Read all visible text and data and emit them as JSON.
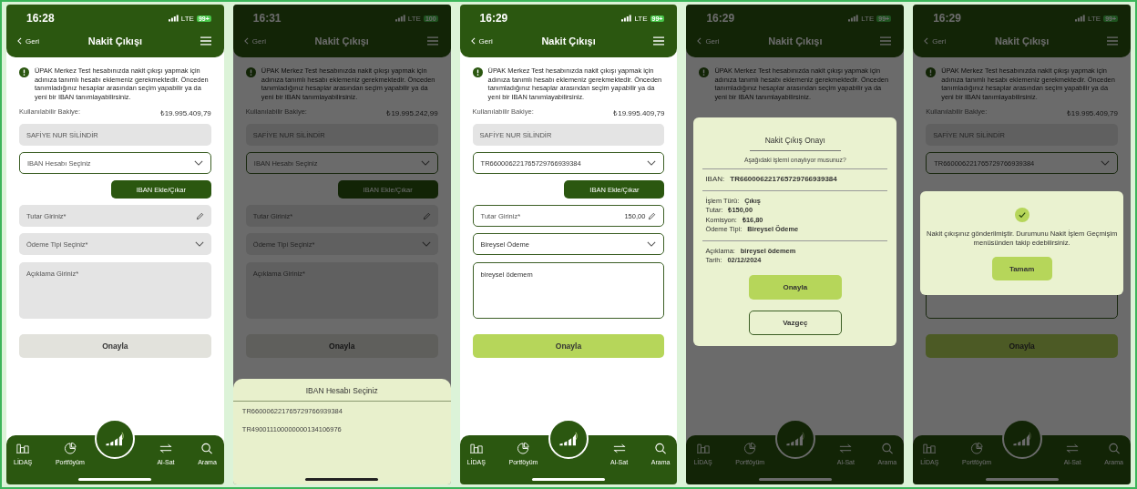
{
  "phones": [
    {
      "status": {
        "time": "16:28",
        "network": "LTE",
        "battery": "99+"
      },
      "header": {
        "back": "Geri",
        "title": "Nakit Çıkışı"
      },
      "notice": "ÜPAK Merkez Test hesabınızda nakit çıkışı yapmak için adınıza tanımlı hesabı eklemeniz gerekmektedir. Önceden tanımladığınız hesaplar arasından seçim yapabilir ya da yeni bir IBAN tanımlayabilirsiniz.",
      "form": {
        "balance_label": "Kullanılabilir Bakiye:",
        "balance_value": "₺19.995.409,79",
        "holder": "SAFİYE NUR SİLİNDİR",
        "iban_select": {
          "placeholder": "IBAN Hesabı Seçiniz"
        },
        "iban_button": "IBAN Ekle/Çıkar",
        "amount": {
          "placeholder": "Tutar Giriniz*"
        },
        "payment_type": {
          "placeholder": "Ödeme Tipi Seçiniz*"
        },
        "description": {
          "placeholder": "Açıklama Giriniz*"
        },
        "submit": {
          "label": "Onayla",
          "enabled": false
        }
      },
      "nav": [
        "LİDAŞ",
        "Portföyüm",
        "Al-Sat",
        "Arama"
      ]
    },
    {
      "status": {
        "time": "16:31",
        "network": "LTE",
        "battery": "100"
      },
      "header": {
        "back": "Geri",
        "title": "Nakit Çıkışı"
      },
      "notice": "ÜPAK Merkez Test hesabınızda nakit çıkışı yapmak için adınıza tanımlı hesabı eklemeniz gerekmektedir. Önceden tanımladığınız hesaplar arasından seçim yapabilir ya da yeni bir IBAN tanımlayabilirsiniz.",
      "form": {
        "balance_label": "Kullanılabilir Bakiye:",
        "balance_value": "₺19.995.242,99",
        "holder": "SAFİYE NUR SİLİNDİR",
        "iban_select": {
          "placeholder": "IBAN Hesabı Seçiniz"
        },
        "iban_button": "IBAN Ekle/Çıkar",
        "amount": {
          "placeholder": "Tutar Giriniz*"
        },
        "payment_type": {
          "placeholder": "Ödeme Tipi Seçiniz*"
        },
        "description": {
          "placeholder": "Açıklama Giriniz*"
        },
        "submit": {
          "label": "Onayla",
          "enabled": false
        }
      },
      "overlay": {
        "kind": "sheet",
        "title": "IBAN Hesabı Seçiniz",
        "items": [
          "TR660006221765729766939384",
          "TR490011100000000134106976"
        ]
      }
    },
    {
      "status": {
        "time": "16:29",
        "network": "LTE",
        "battery": "99+"
      },
      "header": {
        "back": "Geri",
        "title": "Nakit Çıkışı"
      },
      "notice": "ÜPAK Merkez Test hesabınızda nakit çıkışı yapmak için adınıza tanımlı hesabı eklemeniz gerekmektedir. Önceden tanımladığınız hesaplar arasından seçim yapabilir ya da yeni bir IBAN tanımlayabilirsiniz.",
      "form": {
        "balance_label": "Kullanılabilir Bakiye:",
        "balance_value": "₺19.995.409,79",
        "holder": "SAFİYE NUR SİLİNDİR",
        "iban_select": {
          "value": "TR660006221765729766939384"
        },
        "iban_button": "IBAN Ekle/Çıkar",
        "amount": {
          "placeholder": "Tutar Giriniz*",
          "value": "150,00"
        },
        "payment_type": {
          "value": "Bireysel Ödeme"
        },
        "description": {
          "value": "bireysel ödemem"
        },
        "submit": {
          "label": "Onayla",
          "enabled": true
        }
      },
      "nav": [
        "LİDAŞ",
        "Portföyüm",
        "Al-Sat",
        "Arama"
      ]
    },
    {
      "status": {
        "time": "16:29",
        "network": "LTE",
        "battery": "99+"
      },
      "header": {
        "back": "Geri",
        "title": "Nakit Çıkışı"
      },
      "notice": "ÜPAK Merkez Test hesabınızda nakit çıkışı yapmak için adınıza tanımlı hesabı eklemeniz gerekmektedir. Önceden tanımladığınız hesaplar arasından seçim yapabilir ya da yeni bir IBAN tanımlayabilirsiniz.",
      "nav": [
        "LİDAŞ",
        "Portföyüm",
        "Al-Sat",
        "Arama"
      ],
      "overlay": {
        "kind": "confirm",
        "title": "Nakit Çıkış Onayı",
        "question": "Aşağıdaki işlemi onaylıyor musunuz?",
        "sections": [
          [
            {
              "label": "IBAN:",
              "value": "TR660006221765729766939384"
            }
          ],
          [
            {
              "label": "İşlem Türü:",
              "value": "Çıkış"
            },
            {
              "label": "Tutar:",
              "value": "₺150,00"
            },
            {
              "label": "Komisyon:",
              "value": "₺16,80"
            },
            {
              "label": "Ödeme Tipi:",
              "value": "Bireysel Ödeme"
            }
          ],
          [
            {
              "label": "Açıklama:",
              "value": "bireysel ödemem"
            },
            {
              "label": "Tarih:",
              "value": "02/12/2024"
            }
          ]
        ],
        "confirm": "Onayla",
        "cancel": "Vazgeç"
      }
    },
    {
      "status": {
        "time": "16:29",
        "network": "LTE",
        "battery": "99+"
      },
      "header": {
        "back": "Geri",
        "title": "Nakit Çıkışı"
      },
      "notice": "ÜPAK Merkez Test hesabınızda nakit çıkışı yapmak için adınıza tanımlı hesabı eklemeniz gerekmektedir. Önceden tanımladığınız hesaplar arasından seçim yapabilir ya da yeni bir IBAN tanımlayabilirsiniz.",
      "form": {
        "balance_label": "Kullanılabilir Bakiye:",
        "balance_value": "₺19.995.409,79",
        "holder": "SAFİYE NUR SİLİNDİR",
        "iban_select": {
          "value": "TR660006221765729766939384"
        },
        "description": {
          "filled": true
        },
        "submit": {
          "label": "Onayla",
          "enabled": true
        }
      },
      "nav": [
        "LİDAŞ",
        "Portföyüm",
        "Al-Sat",
        "Arama"
      ],
      "overlay": {
        "kind": "success",
        "message": "Nakit çıkışınız gönderilmiştir. Durumunu Nakit İşlem Geçmişim menüsünden takip edebilirsiniz.",
        "button": "Tamam"
      }
    }
  ]
}
